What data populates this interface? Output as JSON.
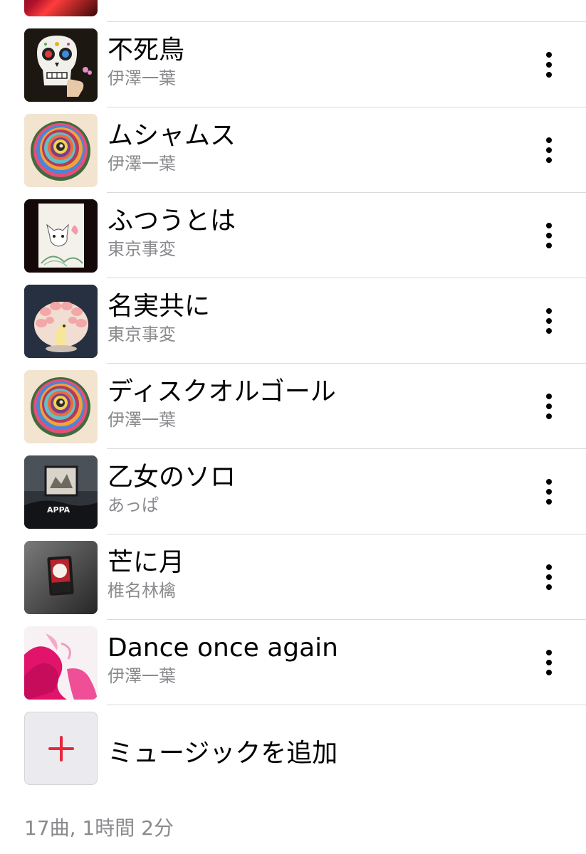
{
  "tracks": [
    {
      "title": "不死鳥",
      "artist": "伊澤一葉",
      "art_icon": "skull-artwork"
    },
    {
      "title": "ムシャムス",
      "artist": "伊澤一葉",
      "art_icon": "spiral-artwork"
    },
    {
      "title": "ふつうとは",
      "artist": "東京事変",
      "art_icon": "cat-artwork"
    },
    {
      "title": "名実共に",
      "artist": "東京事変",
      "art_icon": "peacock-artwork"
    },
    {
      "title": "ディスクオルゴール",
      "artist": "伊澤一葉",
      "art_icon": "spiral-artwork"
    },
    {
      "title": "乙女のソロ",
      "artist": "あっぱ",
      "art_icon": "appa-artwork"
    },
    {
      "title": "芒に月",
      "artist": "椎名林檎",
      "art_icon": "hanafuda-artwork"
    },
    {
      "title": "Dance once again",
      "artist": "伊澤一葉",
      "art_icon": "dance-artwork"
    }
  ],
  "add_music": {
    "label": "ミュージックを追加",
    "icon": "plus-icon"
  },
  "summary": "17曲, 1時間 2分",
  "colors": {
    "accent": "#e8263a",
    "secondary_text": "#8a8a8e",
    "separator": "#d9d9de"
  }
}
